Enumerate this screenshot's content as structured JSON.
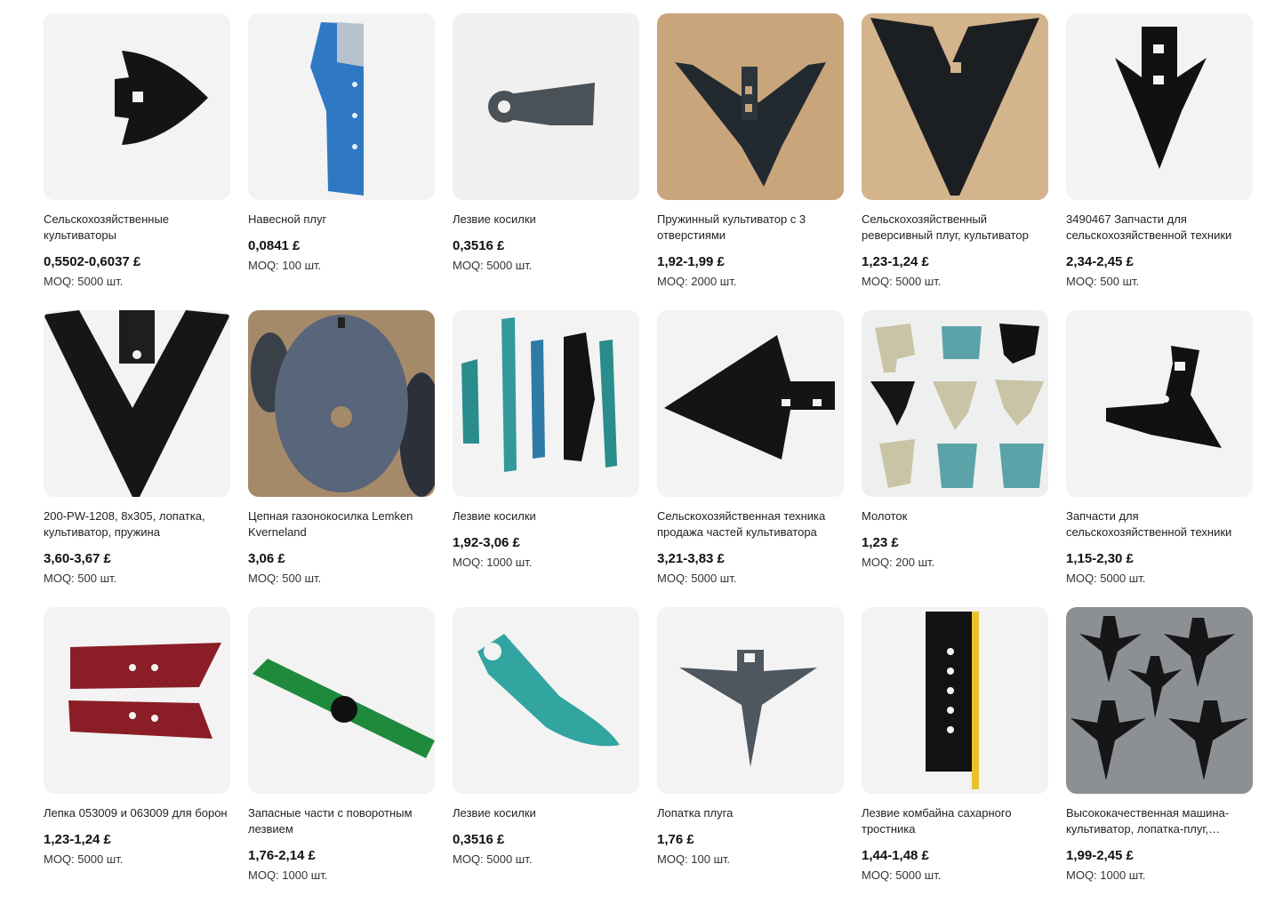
{
  "products": [
    {
      "title": "Сельскохозяйственные культиваторы",
      "price": "0,5502-0,6037 £",
      "moq": "MOQ: 5000 шт.",
      "image": "cultivator-sweep-image"
    },
    {
      "title": "Навесной плуг",
      "price": "0,0841 £",
      "moq": "MOQ: 100 шт.",
      "image": "plough-blade-image"
    },
    {
      "title": "Лезвие косилки",
      "price": "0,3516 £",
      "moq": "MOQ: 5000 шт.",
      "image": "mower-blade-image"
    },
    {
      "title": "Пружинный культиватор с 3 отверстиями",
      "price": "1,92-1,99 £",
      "moq": "MOQ: 2000 шт.",
      "image": "spring-cultivator-image"
    },
    {
      "title": "Сельскохозяйственный реверсивный плуг, культиватор",
      "price": "1,23-1,24 £",
      "moq": "MOQ: 5000 шт.",
      "image": "reversible-plough-image"
    },
    {
      "title": "3490467 Запчасти для сельскохозяйственной техники",
      "price": "2,34-2,45 £",
      "moq": "MOQ: 500 шт.",
      "image": "cultivator-point-image"
    },
    {
      "title": "200-PW-1208, 8x305, лопатка, культиватор, пружина",
      "price": "3,60-3,67 £",
      "moq": "MOQ: 500 шт.",
      "image": "v-sweep-image"
    },
    {
      "title": "Цепная газонокосилка Lemken Kverneland",
      "price": "3,06 £",
      "moq": "MOQ: 500 шт.",
      "image": "plough-disc-image"
    },
    {
      "title": "Лезвие косилки",
      "price": "1,92-3,06 £",
      "moq": "MOQ: 1000 шт.",
      "image": "flail-blades-image"
    },
    {
      "title": "Сельскохозяйственная техника продажа частей культиватора",
      "price": "3,21-3,83 £",
      "moq": "MOQ: 5000 шт.",
      "image": "arrow-sweep-image"
    },
    {
      "title": "Молоток",
      "price": "1,23 £",
      "moq": "MOQ: 200 шт.",
      "image": "hammers-image"
    },
    {
      "title": "Запчасти для сельскохозяйственной техники",
      "price": "1,15-2,30 £",
      "moq": "MOQ: 5000 шт.",
      "image": "sweep-shank-image"
    },
    {
      "title": "Лепка 053009 и 063009 для борон",
      "price": "1,23-1,24 £",
      "moq": "MOQ: 5000 шт.",
      "image": "red-blades-image"
    },
    {
      "title": "Запасные части с поворотным лезвием",
      "price": "1,76-2,14 £",
      "moq": "MOQ: 1000 шт.",
      "image": "rotary-blade-image"
    },
    {
      "title": "Лезвие косилки",
      "price": "0,3516 £",
      "moq": "MOQ: 5000 шт.",
      "image": "teal-blade-image"
    },
    {
      "title": "Лопатка плуга",
      "price": "1,76 £",
      "moq": "MOQ: 100 шт.",
      "image": "grey-sweep-image"
    },
    {
      "title": "Лезвие комбайна сахарного тростника",
      "price": "1,44-1,48 £",
      "moq": "MOQ: 5000 шт.",
      "image": "cane-blade-image"
    },
    {
      "title": "Высококачественная машина-культиватор, лопатка-плуг, сельскохозяйственная",
      "price": "1,99-2,45 £",
      "moq": "MOQ: 1000 шт.",
      "image": "sweeps-set-image"
    }
  ]
}
